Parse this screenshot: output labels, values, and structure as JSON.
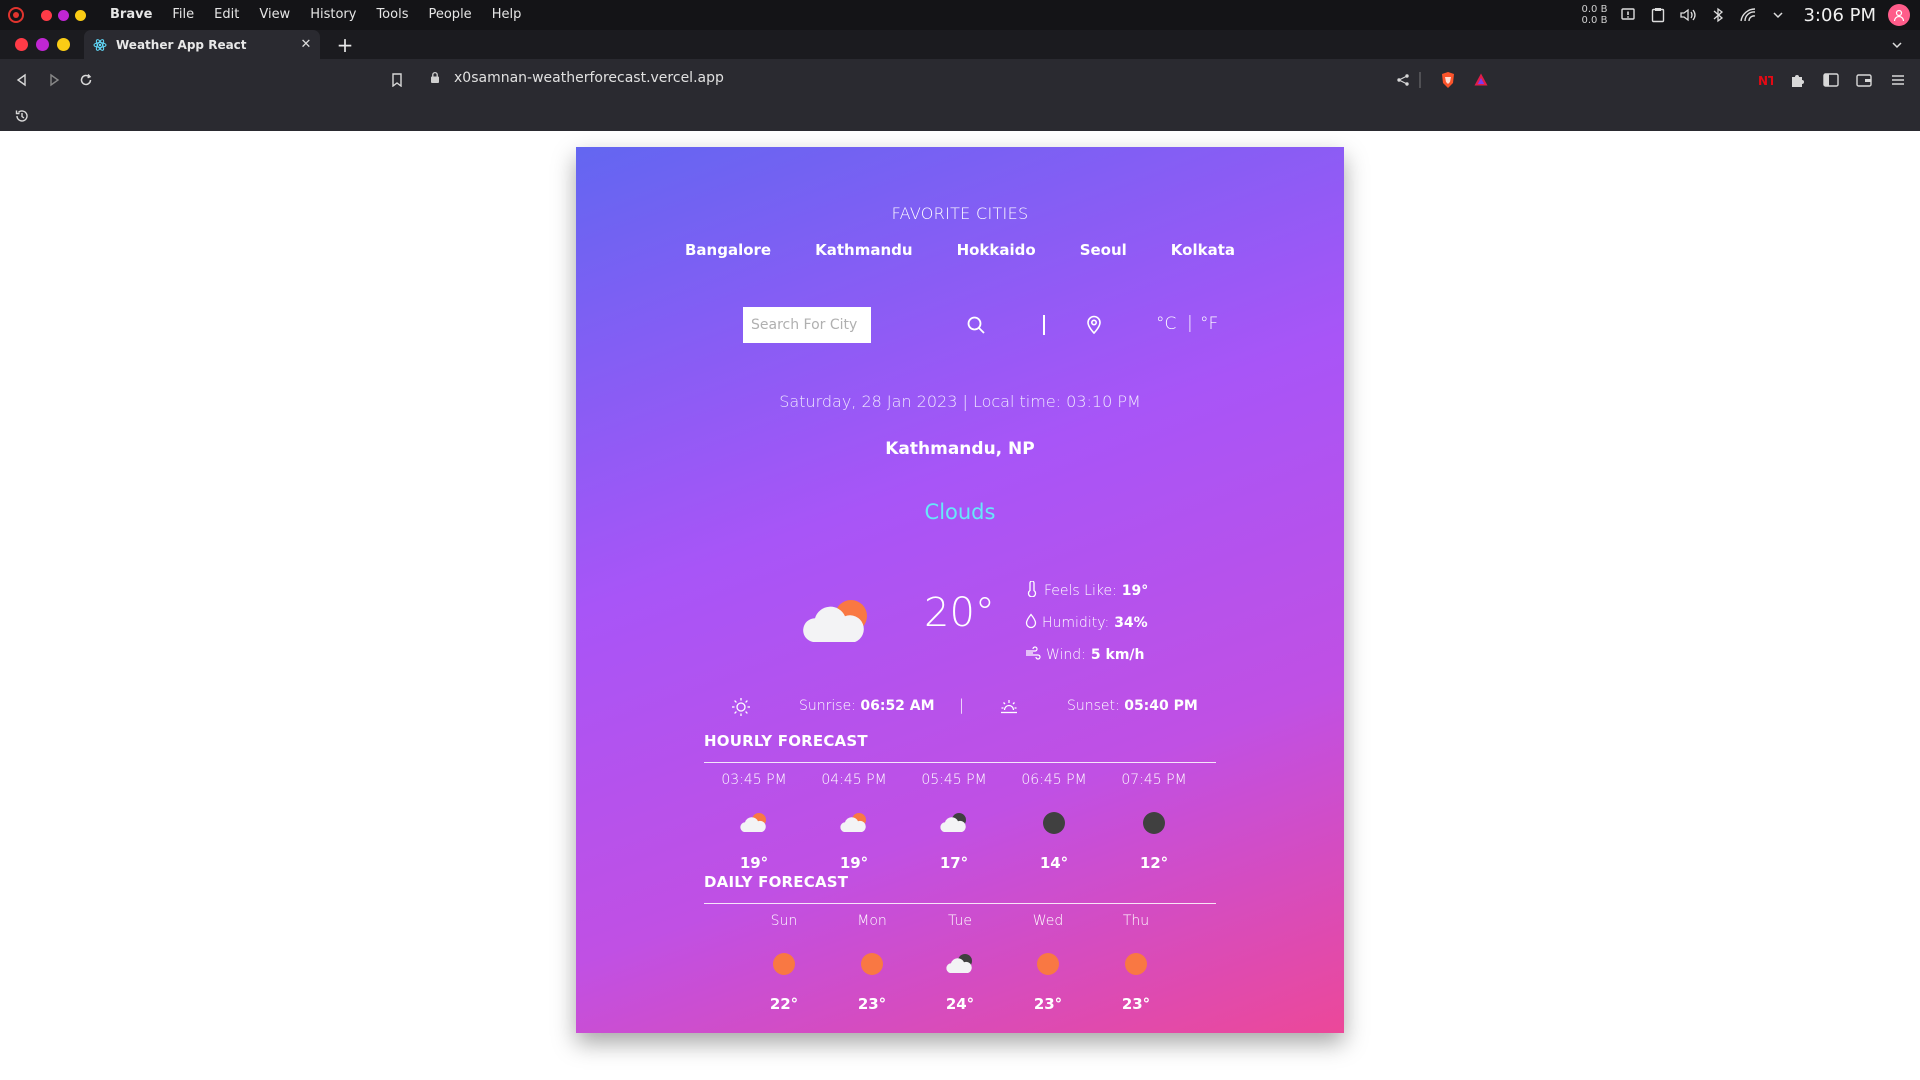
{
  "os": {
    "app_name": "Brave",
    "menu": [
      "File",
      "Edit",
      "View",
      "History",
      "Tools",
      "People",
      "Help"
    ],
    "net_up": "0.0 B",
    "net_down": "0.0 B",
    "clock": "3:06 PM"
  },
  "browser": {
    "tab_title": "Weather App React",
    "url": "x0samnan-weatherforecast.vercel.app"
  },
  "weather": {
    "favorites_title": "FAVORITE CITIES",
    "cities": [
      "Bangalore",
      "Kathmandu",
      "Hokkaido",
      "Seoul",
      "Kolkata"
    ],
    "search_placeholder": "Search For City",
    "units": {
      "celsius": "°C",
      "separator": "|",
      "fahrenheit": "°F"
    },
    "datetime": "Saturday, 28 Jan 2023 | Local time: 03:10 PM",
    "location": "Kathmandu, NP",
    "condition": "Clouds",
    "temperature": "20°",
    "feels_like_label": "Feels Like:",
    "feels_like": "19°",
    "humidity_label": "Humidity:",
    "humidity": "34%",
    "wind_label": "Wind:",
    "wind": "5 km/h",
    "sunrise_label": "Sunrise:",
    "sunrise": "06:52 AM",
    "sunset_label": "Sunset:",
    "sunset": "05:40 PM",
    "hourly_title": "HOURLY FORECAST",
    "hourly": [
      {
        "time": "03:45 PM",
        "temp": "19°",
        "icon": "cloud-sun-icon"
      },
      {
        "time": "04:45 PM",
        "temp": "19°",
        "icon": "cloud-sun-icon"
      },
      {
        "time": "05:45 PM",
        "temp": "17°",
        "icon": "cloud-night-icon"
      },
      {
        "time": "06:45 PM",
        "temp": "14°",
        "icon": "moon-icon"
      },
      {
        "time": "07:45 PM",
        "temp": "12°",
        "icon": "moon-icon"
      }
    ],
    "daily_title": "DAILY FORECAST",
    "daily": [
      {
        "day": "Sun",
        "temp": "22°",
        "icon": "sun-icon"
      },
      {
        "day": "Mon",
        "temp": "23°",
        "icon": "sun-icon"
      },
      {
        "day": "Tue",
        "temp": "24°",
        "icon": "cloud-night-icon"
      },
      {
        "day": "Wed",
        "temp": "23°",
        "icon": "sun-icon"
      },
      {
        "day": "Thu",
        "temp": "23°",
        "icon": "sun-icon"
      }
    ]
  },
  "colors": {
    "gradient_start": "#6366f1",
    "gradient_end": "#ec4899",
    "condition_text": "#67e8f9",
    "sun_orange": "#f97843",
    "moon_dark": "#404040"
  }
}
